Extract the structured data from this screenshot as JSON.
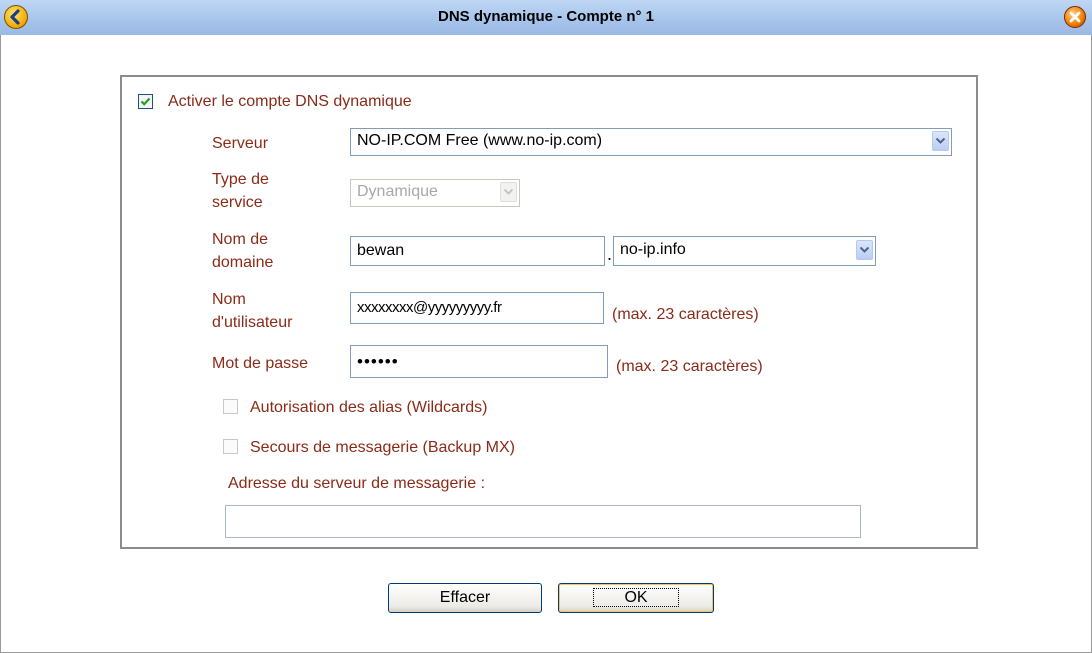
{
  "window": {
    "title": "DNS dynamique - Compte n° 1"
  },
  "form": {
    "enable_label": "Activer le compte DNS dynamique",
    "enable_checked": true,
    "server_label": "Serveur",
    "server_value": "NO-IP.COM Free (www.no-ip.com)",
    "service_type_label_line1": "Type de",
    "service_type_label_line2": "service",
    "service_type_value": "Dynamique",
    "domain_label_line1": "Nom de",
    "domain_label_line2": "domaine",
    "domain_host_value": "bewan",
    "domain_separator": ".",
    "domain_suffix_value": "no-ip.info",
    "username_label_line1": "Nom",
    "username_label_line2": "d'utilisateur",
    "username_value": "xxxxxxxx@yyyyyyyyy.fr",
    "username_hint": "(max. 23 caractères)",
    "password_label": "Mot de passe",
    "password_value": "••••••",
    "password_hint": "(max. 23 caractères)",
    "wildcards_label": "Autorisation des alias (Wildcards)",
    "backup_mx_label": "Secours de messagerie (Backup MX)",
    "mail_server_label": "Adresse du serveur de messagerie :",
    "mail_server_value": ""
  },
  "buttons": {
    "clear_label": "Effacer",
    "ok_label": "OK"
  },
  "colors": {
    "label": "#8b2a17",
    "disabled": "#9a9a9a",
    "titlebar": "#a9c6ec"
  }
}
